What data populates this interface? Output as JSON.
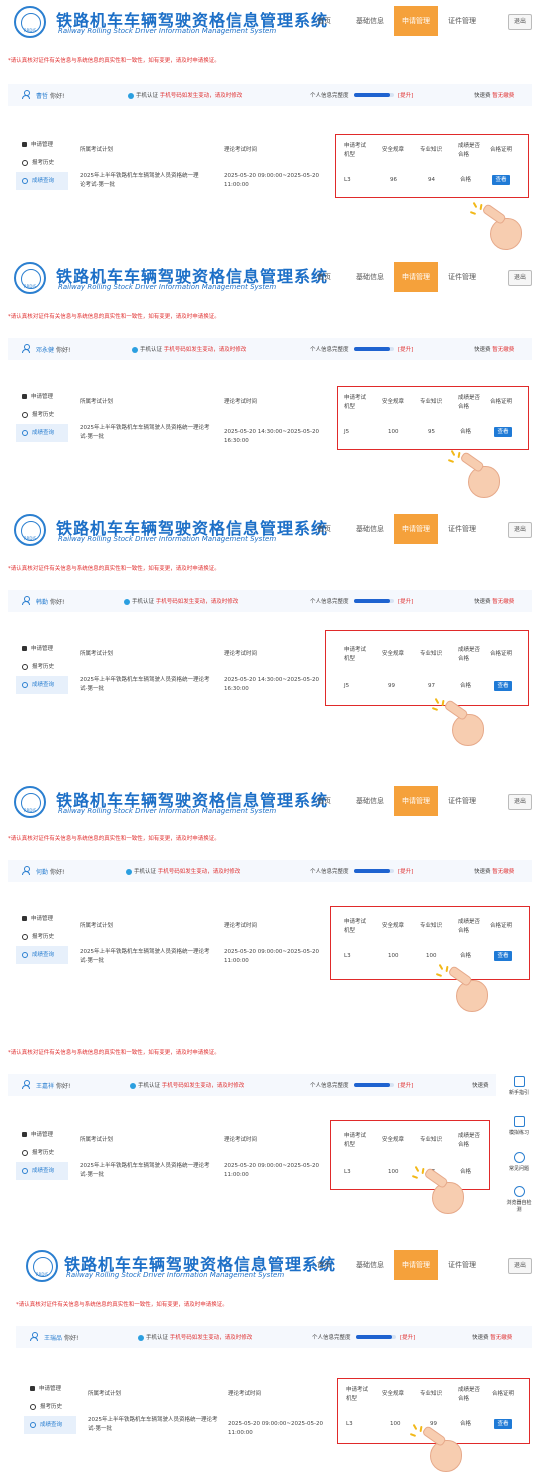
{
  "header": {
    "logo_text": "RRDIS",
    "title_cn": "铁路机车车辆驾驶资格信息管理系统",
    "title_en": "Railway Rolling Stock Driver Information Management System",
    "nav": [
      "首页",
      "基础信息",
      "申请管理",
      "证件管理"
    ],
    "active_nav": "申请管理",
    "logout": "退出"
  },
  "notice": "*请认真核对证件有关信息与系统信息的真实性和一致性，如有变更，请及时申请换证。",
  "userbar": {
    "greeting": "你好!",
    "phone_prefix": "手机认证",
    "phone_warn": "手机号码如发生变动，请及时修改",
    "profile_label": "个人信息完整度",
    "profile_progress": 0.9,
    "upgrade": "[提升]",
    "quick_label": "快速费",
    "quick_value": "暂无缴费"
  },
  "sidebar": [
    "申请管理",
    "报考历史",
    "成绩查询"
  ],
  "table_headers": {
    "plan": "所属考试计划",
    "time": "理论考试时间",
    "type": "申请考试机型",
    "safety": "安全规章",
    "prof": "专业知识",
    "pass": "成绩是否合格",
    "cert": "合格证明"
  },
  "view_label": "查看",
  "records": [
    {
      "name": "曹哲",
      "plan": "2025年上半年铁路机车车辆驾驶人员资格统一理论考试-第一批",
      "time": "2025-05-20 09:00:00~2025-05-20 11:00:00",
      "type": "L3",
      "safety": "96",
      "prof": "94",
      "result": "合格"
    },
    {
      "name": "邓永健",
      "plan": "2025年上半年铁路机车车辆驾驶人员资格统一理论考试-第一批",
      "time": "2025-05-20 14:30:00~2025-05-20 16:30:00",
      "type": "J5",
      "safety": "100",
      "prof": "95",
      "result": "合格"
    },
    {
      "name": "韩勤",
      "plan": "2025年上半年铁路机车车辆驾驶人员资格统一理论考试-第一批",
      "time": "2025-05-20 14:30:00~2025-05-20 16:30:00",
      "type": "J5",
      "safety": "99",
      "prof": "97",
      "result": "合格"
    },
    {
      "name": "何勤",
      "plan": "2025年上半年铁路机车车辆驾驶人员资格统一理论考试-第一批",
      "time": "2025-05-20 09:00:00~2025-05-20 11:00:00",
      "type": "L3",
      "safety": "100",
      "prof": "100",
      "result": "合格"
    },
    {
      "name": "王嘉祥",
      "plan": "2025年上半年铁路机车车辆驾驶人员资格统一理论考试-第一批",
      "time": "2025-05-20 09:00:00~2025-05-20 11:00:00",
      "type": "L3",
      "safety": "100",
      "prof": "97",
      "result": "合格"
    },
    {
      "name": "王瑞品",
      "plan": "2025年上半年铁路机车车辆驾驶人员资格统一理论考试-第一批",
      "time": "2025-05-20 09:00:00~2025-05-20 11:00:00",
      "type": "L3",
      "safety": "100",
      "prof": "99",
      "result": "合格"
    }
  ],
  "right_tools": [
    "新手指引",
    "模拟练习",
    "常见问题",
    "浏览器自检测"
  ]
}
